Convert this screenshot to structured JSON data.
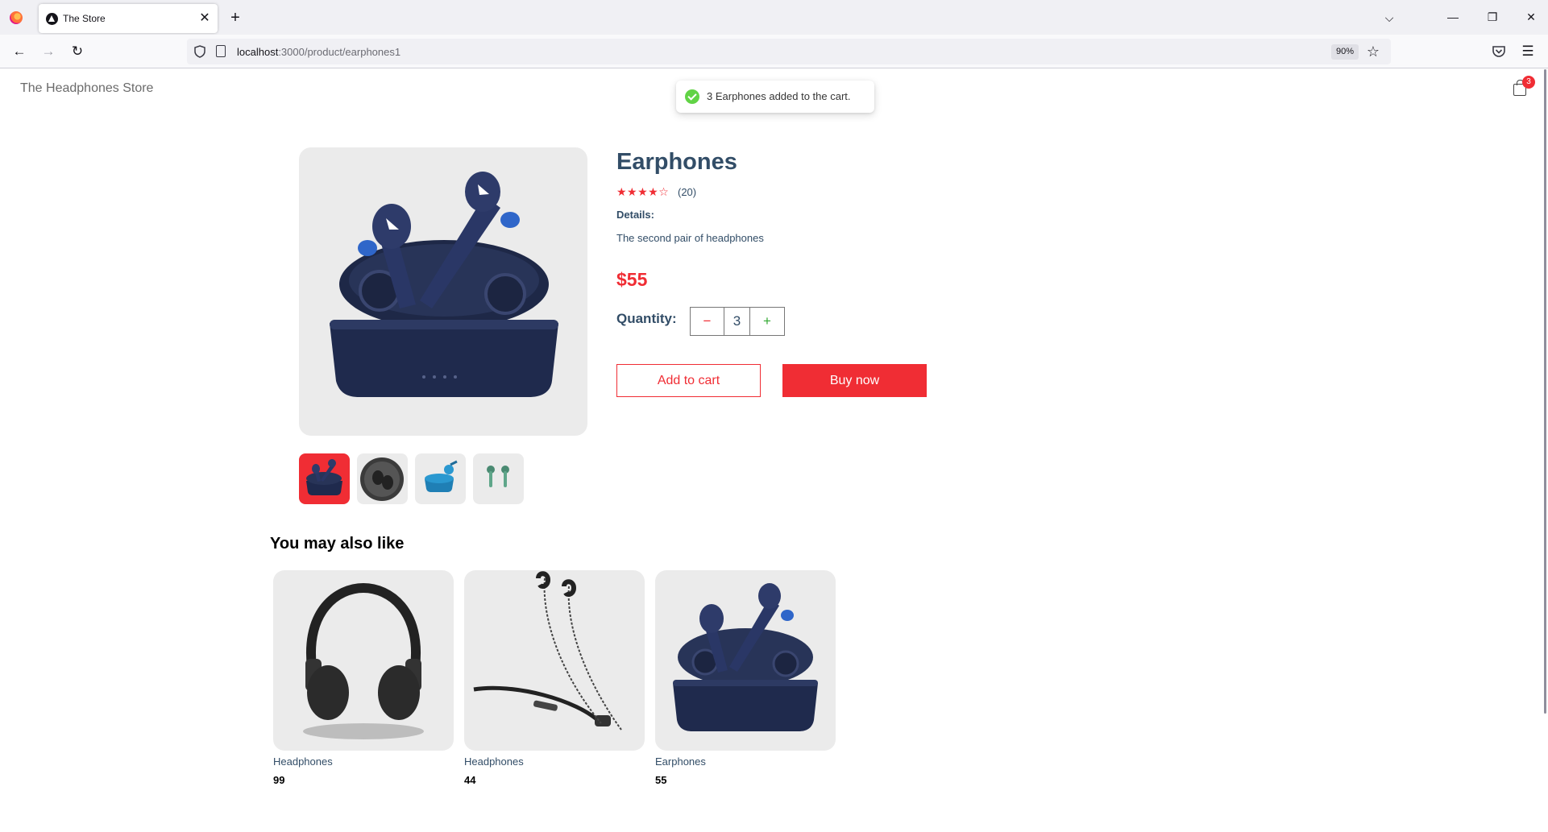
{
  "browser": {
    "tab_title": "The Store",
    "url_host": "localhost",
    "url_path": ":3000/product/earphones1",
    "zoom": "90%"
  },
  "header": {
    "brand": "The Headphones Store",
    "cart_count": "3"
  },
  "toast": {
    "message": "3 Earphones added to the cart."
  },
  "product": {
    "name": "Earphones",
    "stars": "★★★★☆",
    "rating": 4,
    "reviews": "(20)",
    "details_label": "Details:",
    "details_text": "The second pair of headphones",
    "price": "$55",
    "quantity_label": "Quantity:",
    "quantity": "3",
    "minus": "−",
    "plus": "+",
    "add_to_cart": "Add to cart",
    "buy_now": "Buy now"
  },
  "thumbnails": [
    {
      "name": "earbuds-navy-case",
      "selected": true
    },
    {
      "name": "earbuds-dark-round-case",
      "selected": false
    },
    {
      "name": "earbuds-blue-case",
      "selected": false
    },
    {
      "name": "earbuds-green-pair",
      "selected": false
    }
  ],
  "related": {
    "title": "You may also like",
    "items": [
      {
        "name": "Headphones",
        "price": "99"
      },
      {
        "name": "Headphones",
        "price": "44"
      },
      {
        "name": "Earphones",
        "price": "55"
      }
    ]
  },
  "colors": {
    "accent": "#f02d34",
    "text_dark": "#324d67",
    "image_bg": "#ebebeb",
    "toast_check": "#61d345"
  }
}
